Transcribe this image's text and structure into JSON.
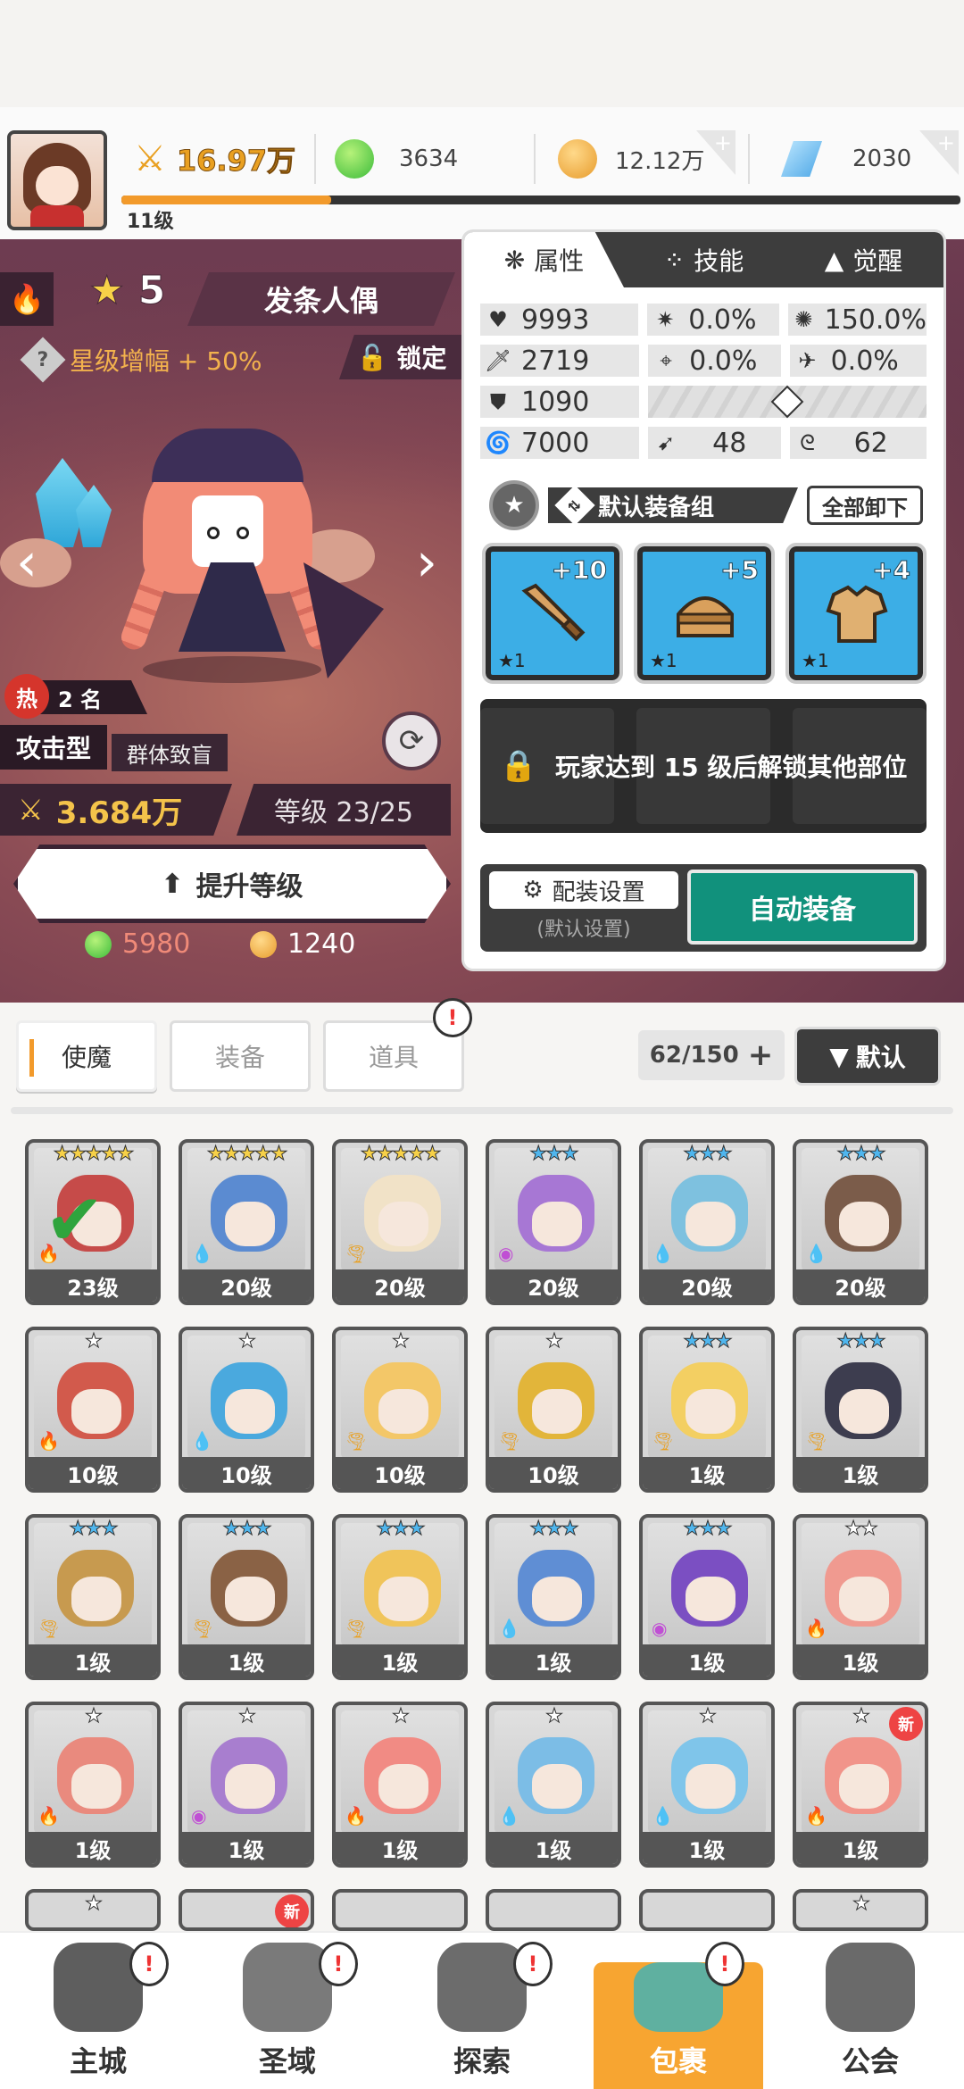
{
  "player": {
    "level": "11级",
    "xp_fraction": 0.25
  },
  "currency": {
    "power": "16.97万",
    "green_gem": "3634",
    "gold": "12.12万",
    "diamond": "2030"
  },
  "hero": {
    "star_level": "5",
    "name": "发条人偶",
    "growth": "星级增幅 + 50%",
    "lock_label": "锁定",
    "hot_label": "热",
    "rank": "2 名",
    "type": "攻击型",
    "subtype": "群体致盲",
    "power": "3.684万",
    "level": "等级 23/25",
    "upgrade_label": "提升等级",
    "cost_green": "5980",
    "cost_gold": "1240"
  },
  "panel": {
    "tabs": [
      "属性",
      "技能",
      "觉醒"
    ],
    "stats": {
      "hp": "9993",
      "crit": "0.0%",
      "crit_dmg": "150.0%",
      "atk": "2719",
      "acc": "0.0%",
      "dodge": "0.0%",
      "def": "1090",
      "speed": "7000",
      "stat_a": "48",
      "stat_b": "62"
    },
    "equip_set_name": "默认装备组",
    "unequip_all": "全部卸下",
    "slots": [
      {
        "plus": "+10",
        "stars": "★1",
        "item": "sword"
      },
      {
        "plus": "+5",
        "stars": "★1",
        "item": "helmet"
      },
      {
        "plus": "+4",
        "stars": "★1",
        "item": "armor"
      }
    ],
    "locked_text": "玩家达到 15 级后解锁其他部位",
    "config_label": "配装设置",
    "config_sub": "(默认设置)",
    "auto_equip": "自动装备"
  },
  "inventory": {
    "tabs": [
      "使魔",
      "装备",
      "道具"
    ],
    "count": "62/150",
    "sort_label": "默认",
    "alert": "!",
    "cards": [
      {
        "stars": "★★★★★",
        "level": "23级",
        "elem": "fire",
        "color": "#c64b49",
        "check": true,
        "new": false
      },
      {
        "stars": "★★★★★",
        "level": "20级",
        "elem": "water",
        "color": "#5b8bd1",
        "check": false,
        "new": false
      },
      {
        "stars": "★★★★★",
        "level": "20级",
        "elem": "wind",
        "color": "#f1e2c7",
        "check": false,
        "new": false
      },
      {
        "stars": "★★★",
        "level": "20级",
        "elem": "dark",
        "color": "#a777d4",
        "check": false,
        "new": false
      },
      {
        "stars": "★★★",
        "level": "20级",
        "elem": "water",
        "color": "#7ec1df",
        "check": false,
        "new": false
      },
      {
        "stars": "★★★",
        "level": "20级",
        "elem": "water",
        "color": "#7b5c4a",
        "check": false,
        "new": false
      },
      {
        "stars": "★",
        "level": "10级",
        "elem": "fire",
        "color": "#d25a4c",
        "check": false,
        "new": false
      },
      {
        "stars": "★",
        "level": "10级",
        "elem": "water",
        "color": "#4aa9de",
        "check": false,
        "new": false
      },
      {
        "stars": "★",
        "level": "10级",
        "elem": "wind",
        "color": "#f3c768",
        "check": false,
        "new": false
      },
      {
        "stars": "★",
        "level": "10级",
        "elem": "wind",
        "color": "#e2b53a",
        "check": false,
        "new": false
      },
      {
        "stars": "★★★",
        "level": "1级",
        "elem": "wind",
        "color": "#f3cf62",
        "check": false,
        "new": false
      },
      {
        "stars": "★★★",
        "level": "1级",
        "elem": "wind",
        "color": "#3d3d4f",
        "check": false,
        "new": false
      },
      {
        "stars": "★★★",
        "level": "1级",
        "elem": "wind",
        "color": "#c79a4f",
        "check": false,
        "new": false
      },
      {
        "stars": "★★★",
        "level": "1级",
        "elem": "wind",
        "color": "#8a6245",
        "check": false,
        "new": false
      },
      {
        "stars": "★★★",
        "level": "1级",
        "elem": "wind",
        "color": "#f0c45a",
        "check": false,
        "new": false
      },
      {
        "stars": "★★★",
        "level": "1级",
        "elem": "water",
        "color": "#5f8ed4",
        "check": false,
        "new": false
      },
      {
        "stars": "★★★",
        "level": "1级",
        "elem": "dark",
        "color": "#7b4fc2",
        "check": false,
        "new": false
      },
      {
        "stars": "★★",
        "level": "1级",
        "elem": "fire",
        "color": "#f09a90",
        "check": false,
        "new": false
      },
      {
        "stars": "★",
        "level": "1级",
        "elem": "fire",
        "color": "#e98a7e",
        "check": false,
        "new": false
      },
      {
        "stars": "★",
        "level": "1级",
        "elem": "dark",
        "color": "#a87ecf",
        "check": false,
        "new": false
      },
      {
        "stars": "★",
        "level": "1级",
        "elem": "fire",
        "color": "#f18b84",
        "check": false,
        "new": false
      },
      {
        "stars": "★",
        "level": "1级",
        "elem": "water",
        "color": "#7cbde6",
        "check": false,
        "new": false
      },
      {
        "stars": "★",
        "level": "1级",
        "elem": "water",
        "color": "#7fc5ea",
        "check": false,
        "new": false
      },
      {
        "stars": "★",
        "level": "1级",
        "elem": "fire",
        "color": "#f1948a",
        "check": false,
        "new": true
      }
    ],
    "partial_row": [
      {
        "stars": "★",
        "new": false
      },
      {
        "stars": "",
        "new": true
      },
      {
        "stars": "",
        "new": false
      },
      {
        "stars": "",
        "new": false
      },
      {
        "stars": "",
        "new": false
      },
      {
        "stars": "★",
        "new": false
      }
    ]
  },
  "nav": [
    {
      "label": "主城",
      "icon": "castle-icon",
      "alert": true
    },
    {
      "label": "圣域",
      "icon": "vortex-icon",
      "alert": true
    },
    {
      "label": "探索",
      "icon": "cannon-icon",
      "alert": true
    },
    {
      "label": "包裹",
      "icon": "bag-icon",
      "alert": true,
      "active": true
    },
    {
      "label": "公会",
      "icon": "guild-icon",
      "alert": false
    }
  ],
  "colors": {
    "accent_orange": "#f29a2b",
    "auto_equip_green": "#11917c",
    "panel_dark": "#3d3d3d",
    "equip_blue": "#3caee6"
  }
}
